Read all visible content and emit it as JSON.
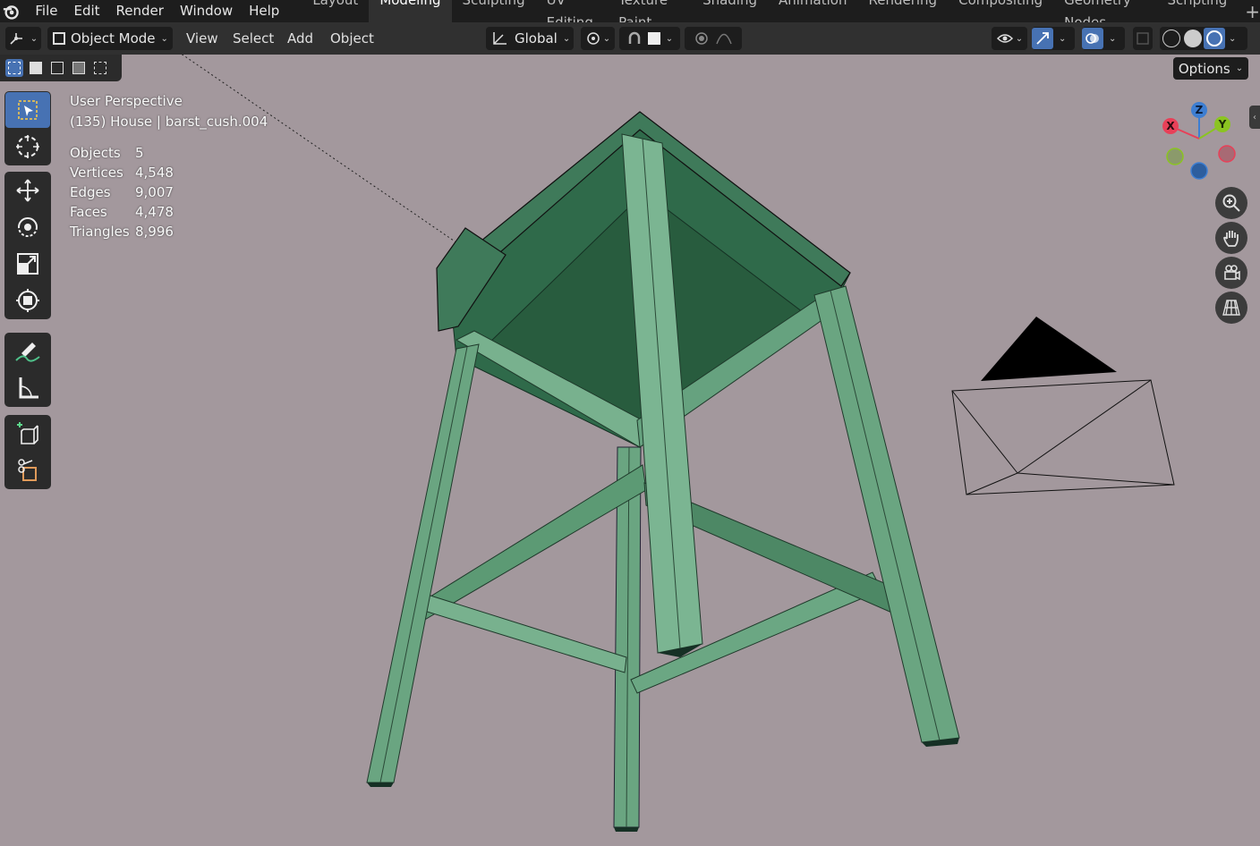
{
  "menus": [
    "File",
    "Edit",
    "Render",
    "Window",
    "Help"
  ],
  "workspaces": [
    "Layout",
    "Modeling",
    "Sculpting",
    "UV Editing",
    "Texture Paint",
    "Shading",
    "Animation",
    "Rendering",
    "Compositing",
    "Geometry Nodes",
    "Scripting"
  ],
  "active_workspace": "Modeling",
  "add_workspace_label": "+",
  "header": {
    "mode": "Object Mode",
    "view": "View",
    "select": "Select",
    "add": "Add",
    "object": "Object",
    "transform_orientation": "Global"
  },
  "options_label": "Options",
  "viewport": {
    "perspective": "User Perspective",
    "active": "(135) House | barst_cush.004"
  },
  "stats": [
    {
      "label": "Objects",
      "value": "5"
    },
    {
      "label": "Vertices",
      "value": "4,548"
    },
    {
      "label": "Edges",
      "value": "9,007"
    },
    {
      "label": "Faces",
      "value": "4,478"
    },
    {
      "label": "Triangles",
      "value": "8,996"
    }
  ],
  "gizmo_axes": {
    "x": "X",
    "y": "Y",
    "z": "Z"
  },
  "colors": {
    "accent": "#4772b3",
    "viewport_bg": "#a3989d",
    "mesh_fill": "#6aa581",
    "axis_x": "#e84058",
    "axis_y": "#8bc421",
    "axis_z": "#3d7ed2"
  }
}
